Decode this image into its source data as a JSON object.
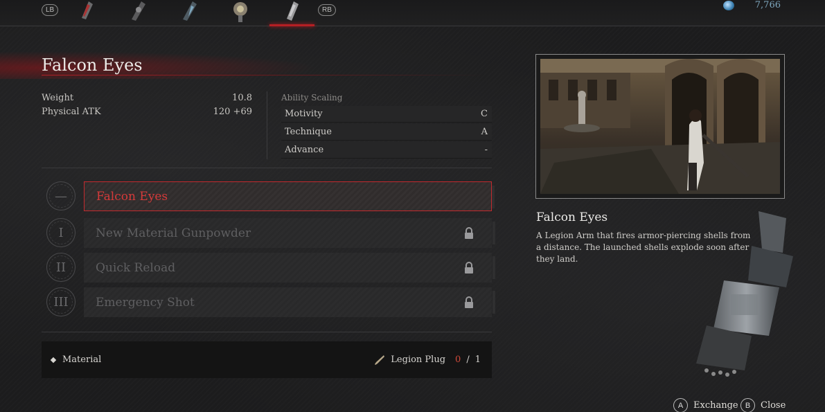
{
  "topbar": {
    "lb_label": "LB",
    "rb_label": "RB",
    "slots": [
      "slot-1",
      "slot-2",
      "slot-3",
      "slot-4",
      "slot-5"
    ],
    "currency_value": "7,766"
  },
  "arm": {
    "name": "Falcon Eyes",
    "stats": [
      {
        "label": "Weight",
        "value": "10.8"
      },
      {
        "label": "Physical ATK",
        "value": "120 +69"
      }
    ],
    "ability_scaling_title": "Ability Scaling",
    "scaling": [
      {
        "label": "Motivity",
        "grade": "C"
      },
      {
        "label": "Technique",
        "grade": "A"
      },
      {
        "label": "Advance",
        "grade": "-"
      }
    ]
  },
  "upgrades": [
    {
      "numeral": "—",
      "name": "Falcon Eyes",
      "active": true,
      "locked": false
    },
    {
      "numeral": "I",
      "name": "New Material Gunpowder",
      "active": false,
      "locked": true
    },
    {
      "numeral": "II",
      "name": "Quick Reload",
      "active": false,
      "locked": true
    },
    {
      "numeral": "III",
      "name": "Emergency Shot",
      "active": false,
      "locked": true
    }
  ],
  "material": {
    "label": "Material",
    "item_name": "Legion Plug",
    "owned": "0",
    "separator": "/",
    "required": "1"
  },
  "details": {
    "title": "Falcon Eyes",
    "description": "A Legion Arm that fires armor-piercing shells from a distance. The launched shells explode soon after they land."
  },
  "footer": {
    "exchange_key": "A",
    "exchange_label": "Exchange",
    "close_key": "B",
    "close_label": "Close"
  },
  "colors": {
    "accent_red": "#c42a2e",
    "currency_blue": "#7fa8bf",
    "owned_count_red": "#d04a3a"
  }
}
